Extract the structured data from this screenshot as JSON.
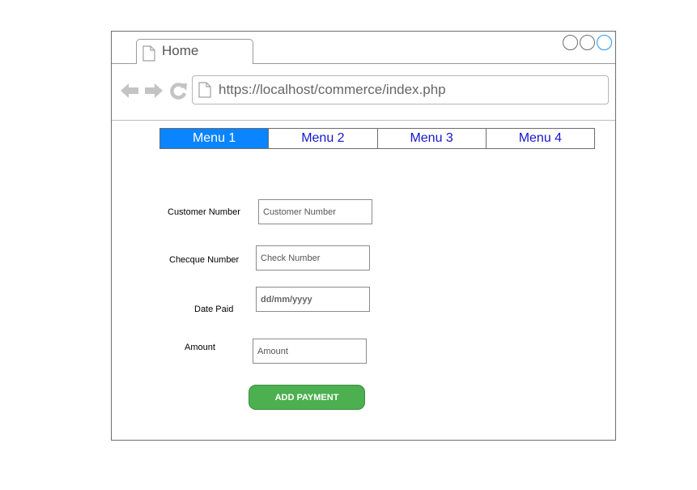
{
  "browser": {
    "tab": {
      "label": "Home"
    },
    "window_controls": [
      "circle",
      "circle",
      "circle"
    ],
    "address_bar": {
      "url": "https://localhost/commerce/index.php"
    }
  },
  "menu": {
    "items": [
      {
        "label": "Menu 1"
      },
      {
        "label": "Menu 2"
      },
      {
        "label": "Menu 3"
      },
      {
        "label": "Menu 4"
      }
    ],
    "active_color": "#0a84ff",
    "link_color": "#1717cc"
  },
  "form": {
    "customer_number": {
      "label": "Customer Number",
      "placeholder": "Customer Number"
    },
    "cheque_number": {
      "label": "Checque Number",
      "placeholder": "Check Number"
    },
    "date_paid": {
      "label": "Date Paid",
      "placeholder": "dd/mm/yyyy"
    },
    "amount": {
      "label": "Amount",
      "placeholder": "Amount"
    },
    "submit_label": "ADD PAYMENT",
    "submit_color": "#4caf50"
  }
}
